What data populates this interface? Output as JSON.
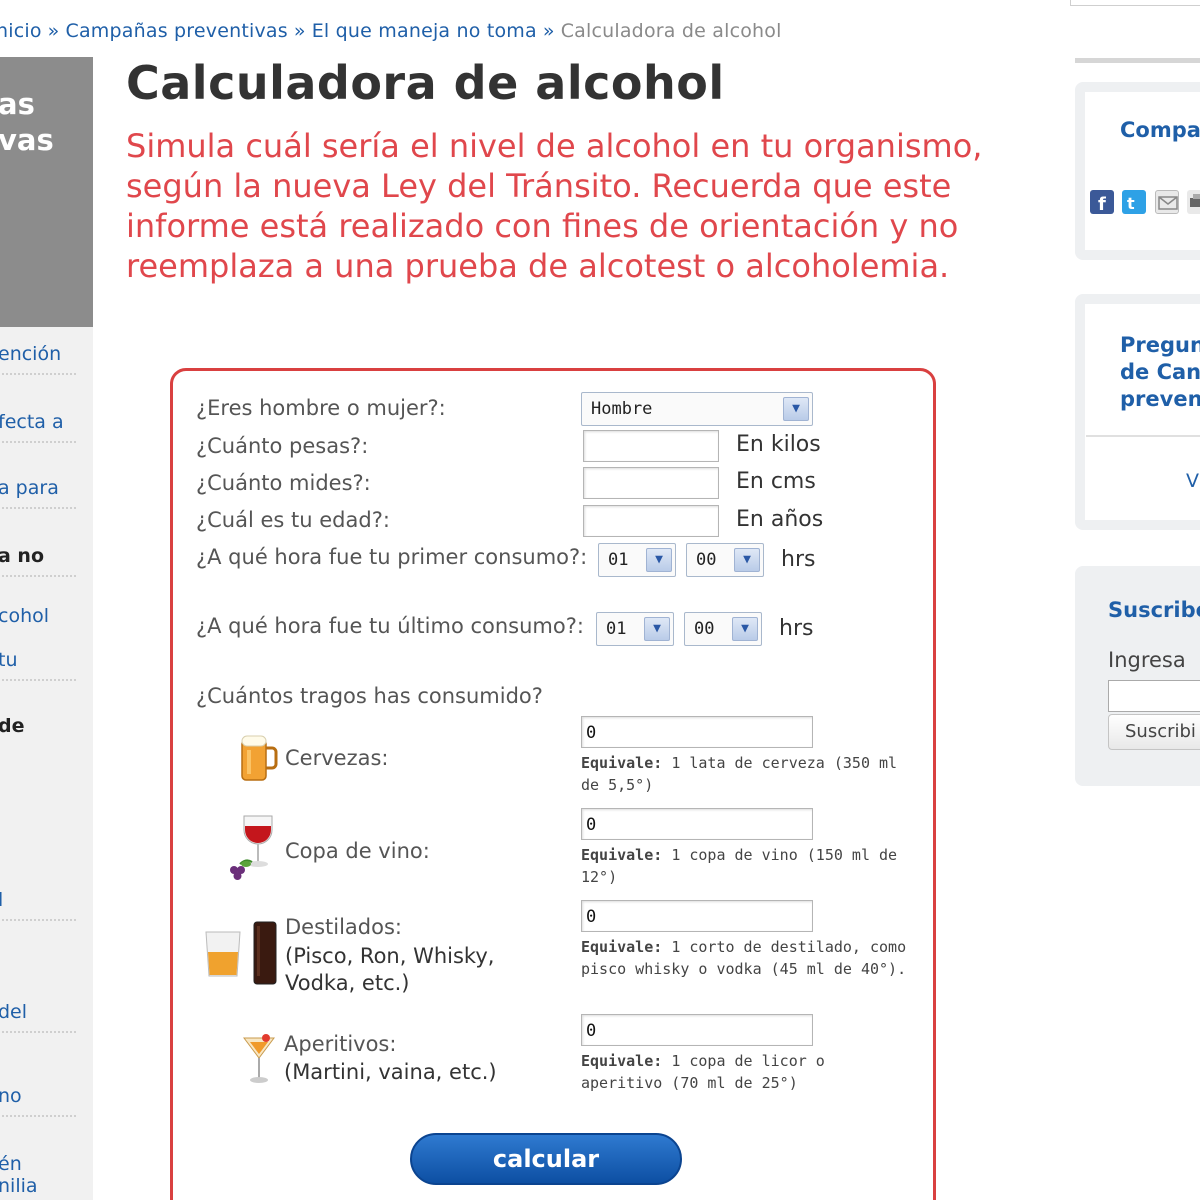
{
  "breadcrumb": {
    "items": [
      "nicio",
      "Campañas preventivas",
      "El que maneja no toma"
    ],
    "separator": "»",
    "current": "Calculadora de alcohol"
  },
  "left_banner": {
    "lines": [
      "as",
      "vas"
    ]
  },
  "left_nav": {
    "items": [
      "ención",
      "fecta a",
      "a para",
      "a no",
      "cohol",
      "tu",
      "de",
      "l",
      "del",
      "no",
      "én",
      "nilia"
    ]
  },
  "page": {
    "title": "Calculadora de alcohol",
    "intro": "Simula cuál sería el nivel de alcohol en tu organismo, según la nueva Ley del Tránsito. Recuerda que este informe está realizado con fines de orientación y no reemplaza a una prueba de alcotest o alcoholemia."
  },
  "form": {
    "gender": {
      "label": "¿Eres hombre o mujer?:",
      "value": "Hombre"
    },
    "weight": {
      "label": "¿Cuánto pesas?:",
      "value": "",
      "unit": "En kilos"
    },
    "height": {
      "label": "¿Cuánto mides?:",
      "value": "",
      "unit": "En cms"
    },
    "age": {
      "label": "¿Cuál es tu edad?:",
      "value": "",
      "unit": "En años"
    },
    "first_time": {
      "label": "¿A qué hora fue tu primer consumo?:",
      "hour": "01",
      "minute": "00",
      "unit": "hrs"
    },
    "last_time": {
      "label": "¿A qué hora fue tu último consumo?:",
      "hour": "01",
      "minute": "00",
      "unit": "hrs"
    },
    "drinks_question": "¿Cuántos tragos has consumido?",
    "drinks": [
      {
        "name": "Cervezas:",
        "value": "0",
        "equiv_label": "Equivale:",
        "equiv_text": "1 lata de cerveza (350 ml de 5,5°)"
      },
      {
        "name": "Copa de vino:",
        "value": "0",
        "equiv_label": "Equivale:",
        "equiv_text": "1 copa de vino (150 ml de 12°)"
      },
      {
        "name": "Destilados:",
        "sub": "(Pisco, Ron, Whisky, Vodka, etc.)",
        "value": "0",
        "equiv_label": "Equivale:",
        "equiv_text": "1 corto de destilado, como pisco whisky o vodka (45 ml de 40°)."
      },
      {
        "name": "Aperitivos:",
        "sub": "(Martini, vaina, etc.)",
        "value": "0",
        "equiv_label": "Equivale:",
        "equiv_text": "1 copa de licor o aperitivo (70 ml de 25°)"
      }
    ],
    "submit_label": "calcular"
  },
  "right_sidebar": {
    "share_title": "Compa",
    "faq_title_lines": [
      "Pregun",
      "de Can",
      "preven"
    ],
    "faq_link": "V",
    "subscribe_title": "Suscribe",
    "subscribe_prompt": "Ingresa",
    "subscribe_button": "Suscribi"
  },
  "colors": {
    "accent": "#1f5fa8",
    "intro_red": "#e0474c",
    "border_red": "#d94040",
    "button_blue": "#0d4fa3"
  }
}
